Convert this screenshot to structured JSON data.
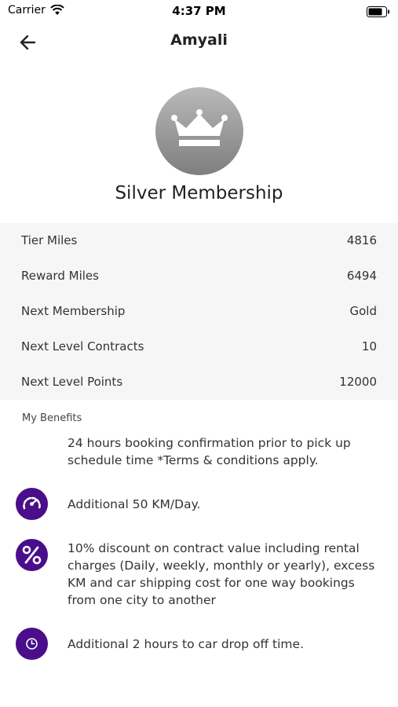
{
  "status_bar": {
    "carrier": "Carrier",
    "time": "4:37 PM"
  },
  "header": {
    "title": "Amyali",
    "back_icon": "arrow-left-icon"
  },
  "membership": {
    "badge_icon": "crown-icon",
    "title": "Silver Membership"
  },
  "stats": [
    {
      "label": "Tier Miles",
      "value": "4816"
    },
    {
      "label": "Reward Miles",
      "value": "6494"
    },
    {
      "label": "Next Membership",
      "value": "Gold"
    },
    {
      "label": "Next Level Contracts",
      "value": "10"
    },
    {
      "label": "Next Level Points",
      "value": "12000"
    }
  ],
  "benefits": {
    "title": "My Benefits",
    "items": [
      {
        "icon": "none",
        "text": "24 hours booking confirmation prior to pick up schedule time *Terms & conditions apply."
      },
      {
        "icon": "speedometer-icon",
        "text": "Additional 50 KM/Day."
      },
      {
        "icon": "percent-icon",
        "text": "10% discount on contract value including rental charges (Daily, weekly, monthly or yearly), excess KM and car shipping cost for one way bookings from one city to another"
      },
      {
        "icon": "clock-icon",
        "text": "Additional 2 hours to car drop off time."
      }
    ]
  },
  "colors": {
    "icon_bg": "#4a0e8a",
    "stats_bg": "#f6f6f6",
    "badge": "#9a9a9a"
  }
}
